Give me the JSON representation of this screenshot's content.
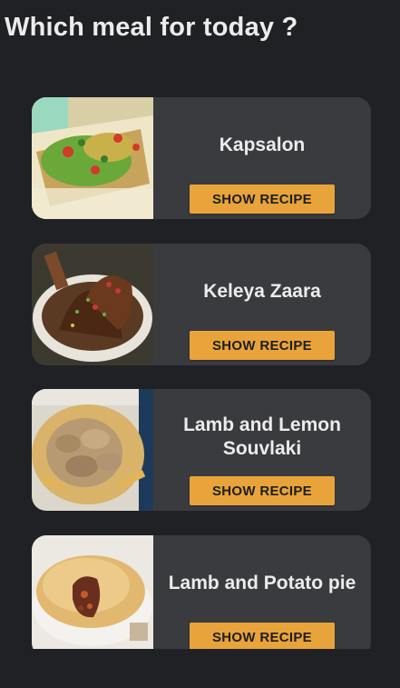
{
  "header": {
    "title": "Which meal for today ?"
  },
  "meals": [
    {
      "name": "Kapsalon",
      "button_label": "SHOW RECIPE",
      "image_icon": "meal-photo-icon"
    },
    {
      "name": "Keleya Zaara",
      "button_label": "SHOW RECIPE",
      "image_icon": "meal-photo-icon"
    },
    {
      "name": "Lamb and Lemon Souvlaki",
      "button_label": "SHOW RECIPE",
      "image_icon": "meal-photo-icon"
    },
    {
      "name": "Lamb and Potato pie",
      "button_label": "SHOW RECIPE",
      "image_icon": "meal-photo-icon"
    }
  ],
  "colors": {
    "background": "#202124",
    "card": "#3a3b3f",
    "accent": "#e8a43a",
    "text": "#ececec"
  }
}
